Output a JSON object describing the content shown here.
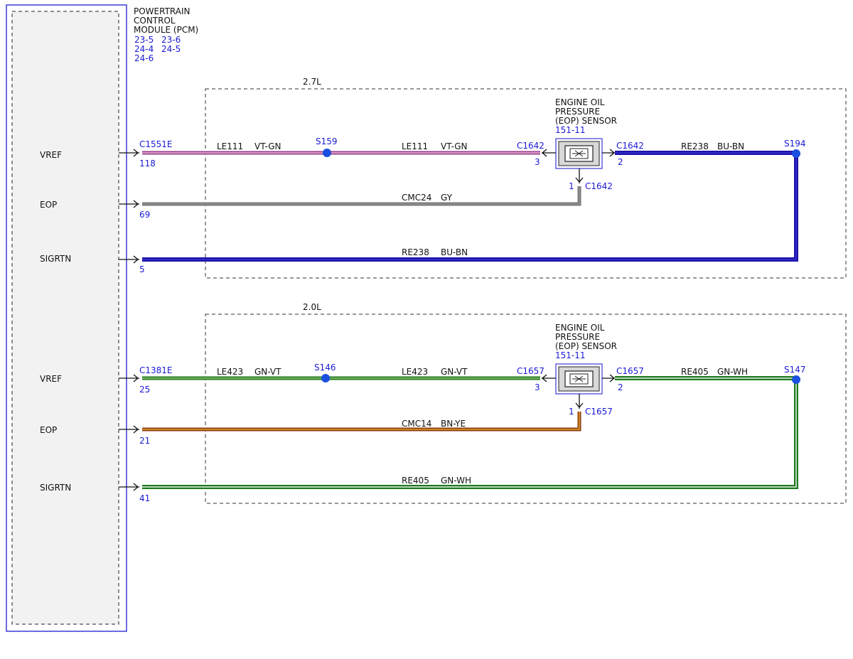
{
  "module": {
    "title_lines": [
      "POWERTRAIN",
      "CONTROL",
      "MODULE (PCM)"
    ],
    "refs": [
      "23-5",
      "23-6",
      "24-4",
      "24-5",
      "24-6"
    ]
  },
  "engines": [
    {
      "label": "2.7L",
      "pcm_connector": "C1551E",
      "splice_left": "S159",
      "splice_right": "S194",
      "sensor": {
        "title_lines": [
          "ENGINE OIL",
          "PRESSURE",
          "(EOP) SENSOR"
        ],
        "ref": "151-11",
        "connector": "C1642",
        "pin_left": "3",
        "pin_right": "2",
        "pin_bottom": "1"
      },
      "pins": [
        {
          "label": "VREF",
          "pin": "118"
        },
        {
          "label": "EOP",
          "pin": "69"
        },
        {
          "label": "SIGRTN",
          "pin": "5"
        }
      ],
      "wires": {
        "vref_a": {
          "circuit": "LE111",
          "color": "VT-GN"
        },
        "vref_b": {
          "circuit": "LE111",
          "color": "VT-GN"
        },
        "eop": {
          "circuit": "CMC24",
          "color": "GY"
        },
        "sig_top": {
          "circuit": "RE238",
          "color": "BU-BN"
        },
        "sigrtn": {
          "circuit": "RE238",
          "color": "BU-BN"
        }
      },
      "wire_colors": {
        "vref": [
          "#9a3d8c",
          "#e8b8d8"
        ],
        "eop": [
          "#7b7b7b",
          "#8f8f8f"
        ],
        "sig": [
          "#1c14a8",
          "#3a2fd0"
        ]
      }
    },
    {
      "label": "2.0L",
      "pcm_connector": "C1381E",
      "splice_left": "S146",
      "splice_right": "S147",
      "sensor": {
        "title_lines": [
          "ENGINE OIL",
          "PRESSURE",
          "(EOP) SENSOR"
        ],
        "ref": "151-11",
        "connector": "C1657",
        "pin_left": "3",
        "pin_right": "2",
        "pin_bottom": "1"
      },
      "pins": [
        {
          "label": "VREF",
          "pin": "25"
        },
        {
          "label": "EOP",
          "pin": "21"
        },
        {
          "label": "SIGRTN",
          "pin": "41"
        }
      ],
      "wires": {
        "vref_a": {
          "circuit": "LE423",
          "color": "GN-VT"
        },
        "vref_b": {
          "circuit": "LE423",
          "color": "GN-VT"
        },
        "eop": {
          "circuit": "CMC14",
          "color": "BN-YE"
        },
        "sig_top": {
          "circuit": "RE405",
          "color": "GN-WH"
        },
        "sigrtn": {
          "circuit": "RE405",
          "color": "GN-WH"
        }
      },
      "wire_colors": {
        "vref": [
          "#1f7a1f",
          "#8fbf6f"
        ],
        "eop": [
          "#8b3a0f",
          "#e0a02a"
        ],
        "sig": [
          "#1f7a1f",
          "#e8f0e8"
        ]
      }
    }
  ],
  "colors": {
    "module_border": "#3b3bd6",
    "module_fill": "#f2f2f2",
    "ref_text": "#1a1ad6",
    "splice": "#1a4fe0"
  }
}
